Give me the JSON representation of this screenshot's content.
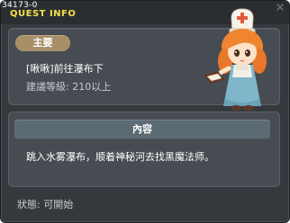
{
  "window": {
    "quest_id": "34173-0",
    "title": "QUEST INFO"
  },
  "quest": {
    "category_badge": "主要",
    "name": "[啾啾]前往瀑布下",
    "level_requirement": "建議等級: 210以上",
    "npc_icon": "npc-cook-girl-with-book"
  },
  "content": {
    "section_title": "內容",
    "description": "跳入水雾瀑布，顺着神秘河去找黑魔法师。"
  },
  "footer": {
    "status": "狀態:  可開始"
  },
  "colors": {
    "title": "#f2e24a",
    "window_bg": "#35393d",
    "panel_bg": "#474c52",
    "badge": "#a98f68",
    "section_bar": "#5c6a73"
  }
}
